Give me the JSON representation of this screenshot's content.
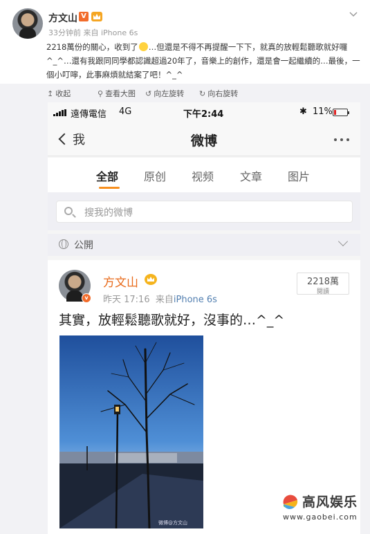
{
  "post": {
    "author": "方文山",
    "verified_badge": "V",
    "meta": "33分钟前 来自 iPhone 6s",
    "text_part1": "2218萬份的關心，收到了",
    "text_part2": "…但還是不得不再提醒一下下，就真的放輕鬆聽歌就好囉^_^…還有我跟同同學都認識超過20年了，音樂上的創作，還是會一起繼續的…最後，一個小叮嚀，此事麻煩就結案了吧！^_^",
    "tools": [
      {
        "icon": "↥",
        "label": "收起"
      },
      {
        "icon": "⚲",
        "label": "查看大图"
      },
      {
        "icon": "↺",
        "label": "向左旋转"
      },
      {
        "icon": "↻",
        "label": "向右旋转"
      }
    ]
  },
  "phone": {
    "status": {
      "carrier": "遠傳電信",
      "network": "4G",
      "time": "下午2:44",
      "bluetooth": "✱",
      "battery": "11%"
    },
    "nav": {
      "back_label": "我",
      "title": "微博"
    },
    "tabs": [
      "全部",
      "原创",
      "视频",
      "文章",
      "图片"
    ],
    "search_placeholder": "搜我的微博",
    "filter_label": "公開",
    "card": {
      "name": "方文山",
      "time": "昨天 17:16",
      "source_prefix": "来自",
      "source": "iPhone 6s",
      "reads_count": "2218萬",
      "reads_label": "閱讀",
      "text": "其實，放輕鬆聽歌就好，沒事的…^_^",
      "photo_watermark": "微博@方文山"
    }
  },
  "brand": {
    "name": "高风娱乐",
    "url": "www.gaobei.com"
  }
}
